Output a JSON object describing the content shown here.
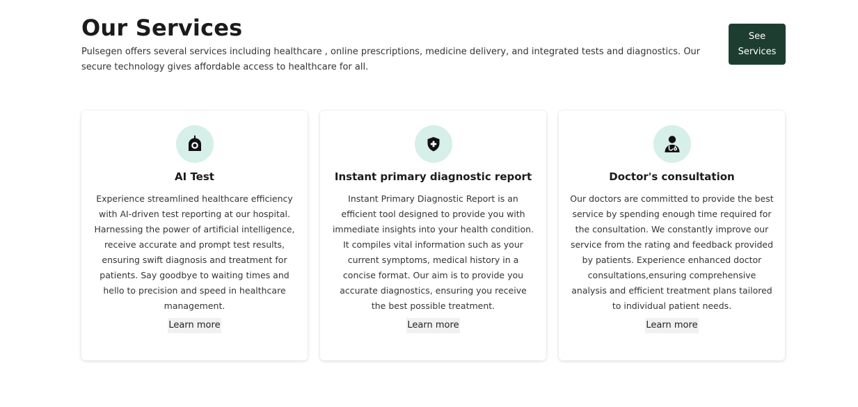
{
  "header": {
    "title": "Our Services",
    "intro": "Pulsegen offers several services including healthcare , online prescriptions, medicine delivery, and integrated tests and diagnostics. Our secure technology gives affordable access to healthcare for all.",
    "see_services_label": "See Services"
  },
  "colors": {
    "button_bg": "#1e3d31",
    "icon_circle_bg": "#d6efe8"
  },
  "cards": [
    {
      "icon": "ai-robot-icon",
      "title": "AI Test",
      "description": "Experience streamlined healthcare efficiency with AI-driven test reporting at our hospital. Harnessing the power of artificial intelligence, receive accurate and prompt test results, ensuring swift diagnosis and treatment for patients. Say goodbye to waiting times and hello to precision and speed in healthcare management.",
      "link_label": "Learn more"
    },
    {
      "icon": "medical-shield-icon",
      "title": "Instant primary diagnostic report",
      "description": "Instant Primary Diagnostic Report is an efficient tool designed to provide you with immediate insights into your health condition. It compiles vital information such as your current symptoms, medical history in a concise format. Our aim is to provide you accurate diagnostics, ensuring you receive the best possible treatment.",
      "link_label": "Learn more"
    },
    {
      "icon": "doctor-icon",
      "title": "Doctor's consultation",
      "description": "Our doctors are committed to provide the best service by spending enough time required for the consultation. We constantly improve our service from the rating and feedback provided by patients. Experience enhanced doctor consultations,ensuring comprehensive analysis and efficient treatment plans tailored to individual patient needs.",
      "link_label": "Learn more"
    }
  ]
}
